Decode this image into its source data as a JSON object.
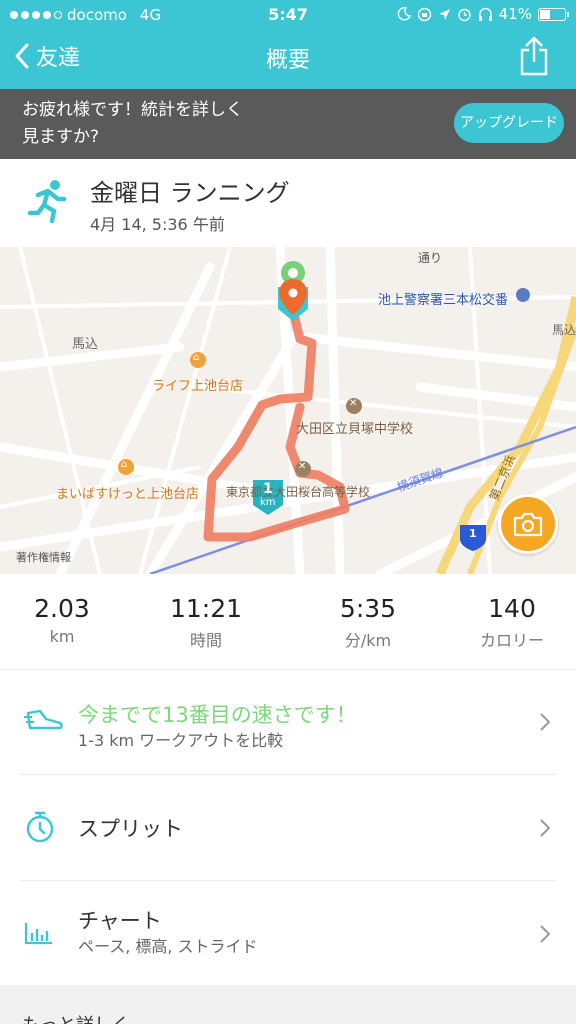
{
  "status_bar": {
    "carrier": "docomo",
    "network": "4G",
    "time": "5:47",
    "battery": "41%"
  },
  "nav": {
    "back_label": "友達",
    "title": "概要"
  },
  "banner": {
    "line1": "お疲れ様です！統計を詳しく",
    "line2": "見ますか?",
    "button": "アップグレード"
  },
  "activity": {
    "title": "金曜日 ランニング",
    "date": "4月 14, 5:36 午前"
  },
  "map": {
    "labels": {
      "police": "池上警察署三本松交番",
      "umagome_left": "馬込",
      "umagome_right": "馬込",
      "life": "ライフ上池台店",
      "school1": "大田区立貝塚中学校",
      "school2": "東京都立大田桜台高等学校",
      "maibasu": "まいばすけっと上池台店",
      "yokosuka": "横須賀線",
      "tokaido": "第二京浜",
      "street": "通り",
      "copyright": "著作権情報",
      "km_marker": "1",
      "km_unit": "km",
      "route_badge": "1"
    }
  },
  "stats": [
    {
      "value": "2.03",
      "unit": "km"
    },
    {
      "value": "11:21",
      "unit": "時間"
    },
    {
      "value": "5:35",
      "unit": "分/km"
    },
    {
      "value": "140",
      "unit": "カロリー"
    }
  ],
  "rows": {
    "compare": {
      "title": "今までで13番目の速さです！",
      "subtitle": "1-3 km ワークアウトを比較"
    },
    "splits": {
      "title": "スプリット"
    },
    "chart": {
      "title": "チャート",
      "subtitle": "ペース, 標高, ストライド"
    }
  },
  "more": {
    "label": "もっと詳しく"
  },
  "colors": {
    "accent": "#3cc6d4",
    "banner": "#5a5a5a",
    "route": "#ef7f63",
    "highlight_text": "#7bd97b",
    "camera": "#f5a623"
  }
}
